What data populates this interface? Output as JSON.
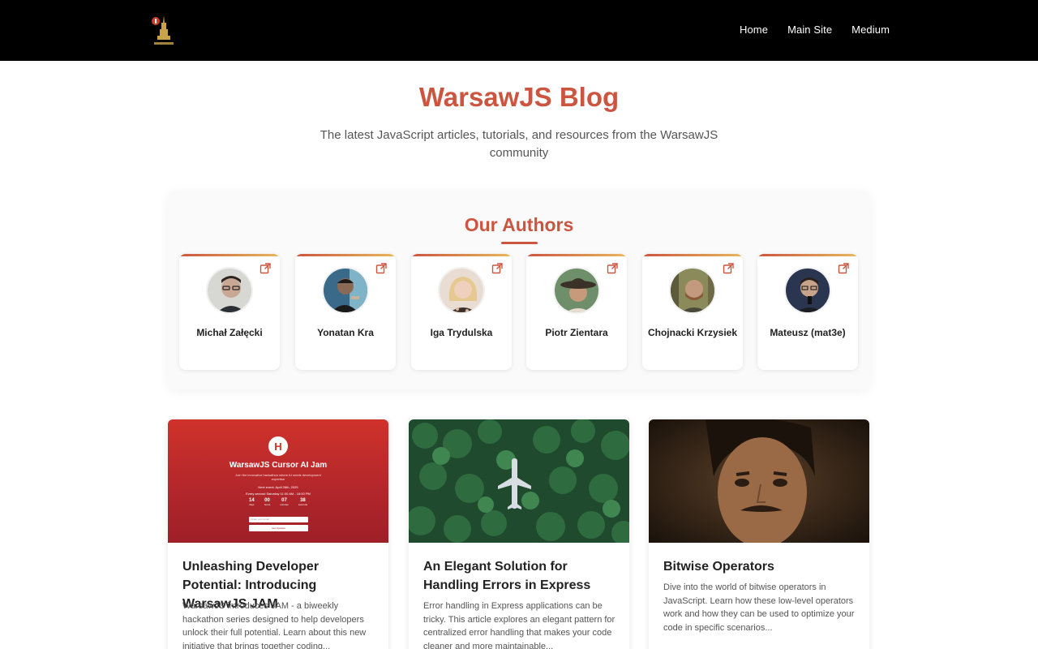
{
  "nav": {
    "home": "Home",
    "main_site": "Main Site",
    "medium": "Medium"
  },
  "header": {
    "title": "WarsawJS Blog",
    "subtitle": "The latest JavaScript articles, tutorials, and resources from the WarsawJS community"
  },
  "authors": {
    "title": "Our Authors",
    "items": [
      {
        "name": "Michał Załęcki"
      },
      {
        "name": "Yonatan Kra"
      },
      {
        "name": "Iga Trydulska"
      },
      {
        "name": "Piotr Zientara"
      },
      {
        "name": "Chojnacki Krzysiek"
      },
      {
        "name": "Mateusz (mat3e)"
      }
    ]
  },
  "posts": [
    {
      "title": "Unleashing Developer Potential: Introducing WarsawJS JAM",
      "excerpt": "WarsawJS introduces JAM - a biweekly hackathon series designed to help developers unlock their full potential. Learn about this new initiative that brings together coding...",
      "image_text": {
        "heading": "WarsawJS Cursor AI Jam",
        "line1": "Join the innovative hackathon where AI meets development expertise",
        "line2": "Next event: April 26th, 2025",
        "line3": "Every second Saturday 11:00 AM - 16:00 PM",
        "countdown": [
          {
            "value": "14",
            "unit": "days"
          },
          {
            "value": "00",
            "unit": "hours"
          },
          {
            "value": "07",
            "unit": "minutes"
          },
          {
            "value": "38",
            "unit": "seconds"
          }
        ],
        "email_placeholder": "Enter your email",
        "button": "Get Updates"
      }
    },
    {
      "title": "An Elegant Solution for Handling Errors in Express",
      "excerpt": "Error handling in Express applications can be tricky. This article explores an elegant pattern for centralized error handling that makes your code cleaner and more maintainable..."
    },
    {
      "title": "Bitwise Operators",
      "excerpt": "Dive into the world of bitwise operators in JavaScript. Learn how these low-level operators work and how they can be used to optimize your code in specific scenarios..."
    }
  ],
  "colors": {
    "accent": "#cc5540",
    "accent_secondary": "#e8b85a",
    "header_bg": "#000000"
  },
  "icons": {
    "author_link": "external-link-icon",
    "logo": "warsawjs-logo-icon"
  }
}
